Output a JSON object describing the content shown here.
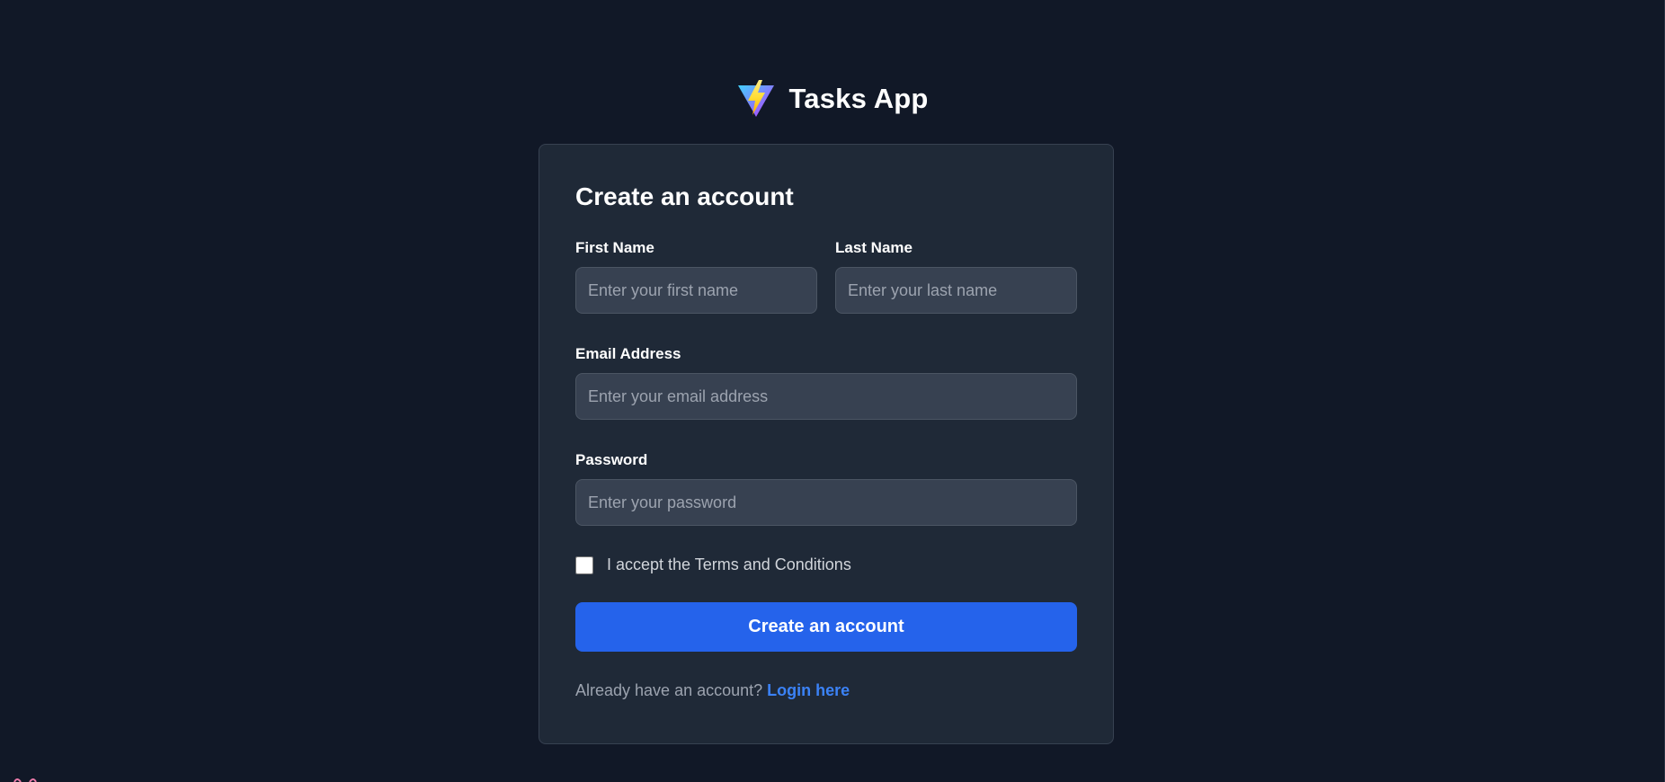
{
  "app": {
    "name": "Tasks App",
    "logo_icon": "vite-logo-icon"
  },
  "form": {
    "title": "Create an account",
    "first_name": {
      "label": "First Name",
      "placeholder": "Enter your first name",
      "value": ""
    },
    "last_name": {
      "label": "Last Name",
      "placeholder": "Enter your last name",
      "value": ""
    },
    "email": {
      "label": "Email Address",
      "placeholder": "Enter your email address",
      "value": ""
    },
    "password": {
      "label": "Password",
      "placeholder": "Enter your password",
      "value": ""
    },
    "terms": {
      "label": "I accept the Terms and Conditions",
      "checked": false
    },
    "submit_label": "Create an account",
    "login_prompt": "Already have an account?",
    "login_link": "Login here"
  },
  "colors": {
    "background": "#111827",
    "card": "#1f2937",
    "input": "#374151",
    "primary": "#2563eb",
    "link": "#3b82f6"
  }
}
